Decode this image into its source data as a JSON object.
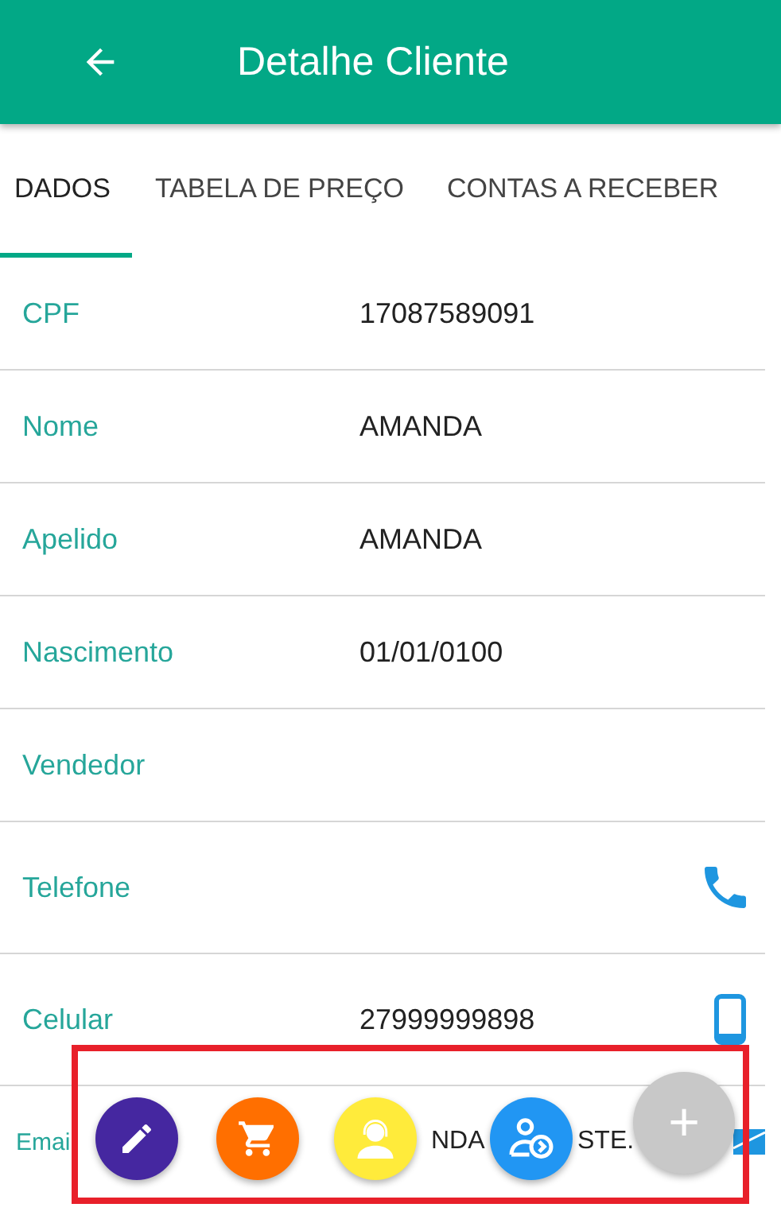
{
  "header": {
    "back_icon": true,
    "title": "Detalhe Cliente"
  },
  "tabs": [
    {
      "label": "DADOS",
      "selected": true
    },
    {
      "label": "TABELA DE PREÇO",
      "selected": false
    },
    {
      "label": "CONTAS A RECEBER",
      "selected": false
    }
  ],
  "fields": [
    {
      "label": "CPF",
      "value": "17087589091",
      "kind": "text"
    },
    {
      "label": "Nome",
      "value": "AMANDA",
      "kind": "text"
    },
    {
      "label": "Apelido",
      "value": "AMANDA",
      "kind": "text"
    },
    {
      "label": "Nascimento",
      "value": "01/01/0100",
      "kind": "text"
    },
    {
      "label": "Vendedor",
      "kind": "text"
    },
    {
      "label": "Telefone",
      "kind": "phone"
    },
    {
      "label": "Celular",
      "value": "27999999898",
      "kind": "mobile"
    },
    {
      "label": "Emai",
      "value_parts": [
        "NDA",
        "STE."
      ],
      "kind": "email"
    }
  ],
  "fab_actions": [
    {
      "kind": "edit",
      "color": "#4527a0"
    },
    {
      "kind": "cart",
      "color": "#ff6f00"
    },
    {
      "kind": "support",
      "color": "#ffeb3b"
    },
    {
      "kind": "client",
      "color": "#2196f3"
    }
  ],
  "fab_main": {
    "label": "+"
  },
  "highlight": true
}
